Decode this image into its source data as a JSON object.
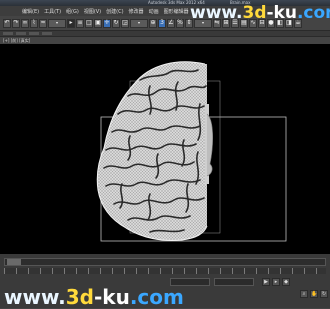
{
  "window": {
    "app_title": "Autodesk 3ds Max 2012 x64",
    "file_name": "Brain.max"
  },
  "menu": {
    "items": [
      "编辑(E)",
      "工具(T)",
      "组(G)",
      "视图(V)",
      "创建(C)",
      "修改器",
      "动画",
      "图形编辑器"
    ]
  },
  "toolbar": {
    "buttons": [
      "undo-icon",
      "redo-icon",
      "link-icon",
      "unlink-icon",
      "bind-icon",
      "filter-dropdown",
      "select-icon",
      "select-by-name-icon",
      "region-select-icon",
      "window-crossing-icon",
      "move-icon",
      "rotate-icon",
      "scale-icon",
      "reference-dropdown",
      "pivot-icon",
      "snap-icon",
      "angle-snap-icon",
      "percent-snap-icon",
      "spinner-snap-icon",
      "named-selection-icon",
      "mirror-icon",
      "align-icon",
      "layer-icon",
      "graphite-icon",
      "curve-editor-icon",
      "schematic-icon",
      "material-editor-icon",
      "render-setup-icon",
      "render-frame-icon",
      "render-icon"
    ]
  },
  "viewport": {
    "label": "[+] [前] [真实]"
  },
  "watermarks": {
    "top": {
      "www": "www.",
      "a": "3d",
      "b": "-ku",
      "c": ".com"
    },
    "bottom": {
      "www": "www.",
      "a": "3d",
      "b": "-ku",
      "c": ".com"
    }
  }
}
